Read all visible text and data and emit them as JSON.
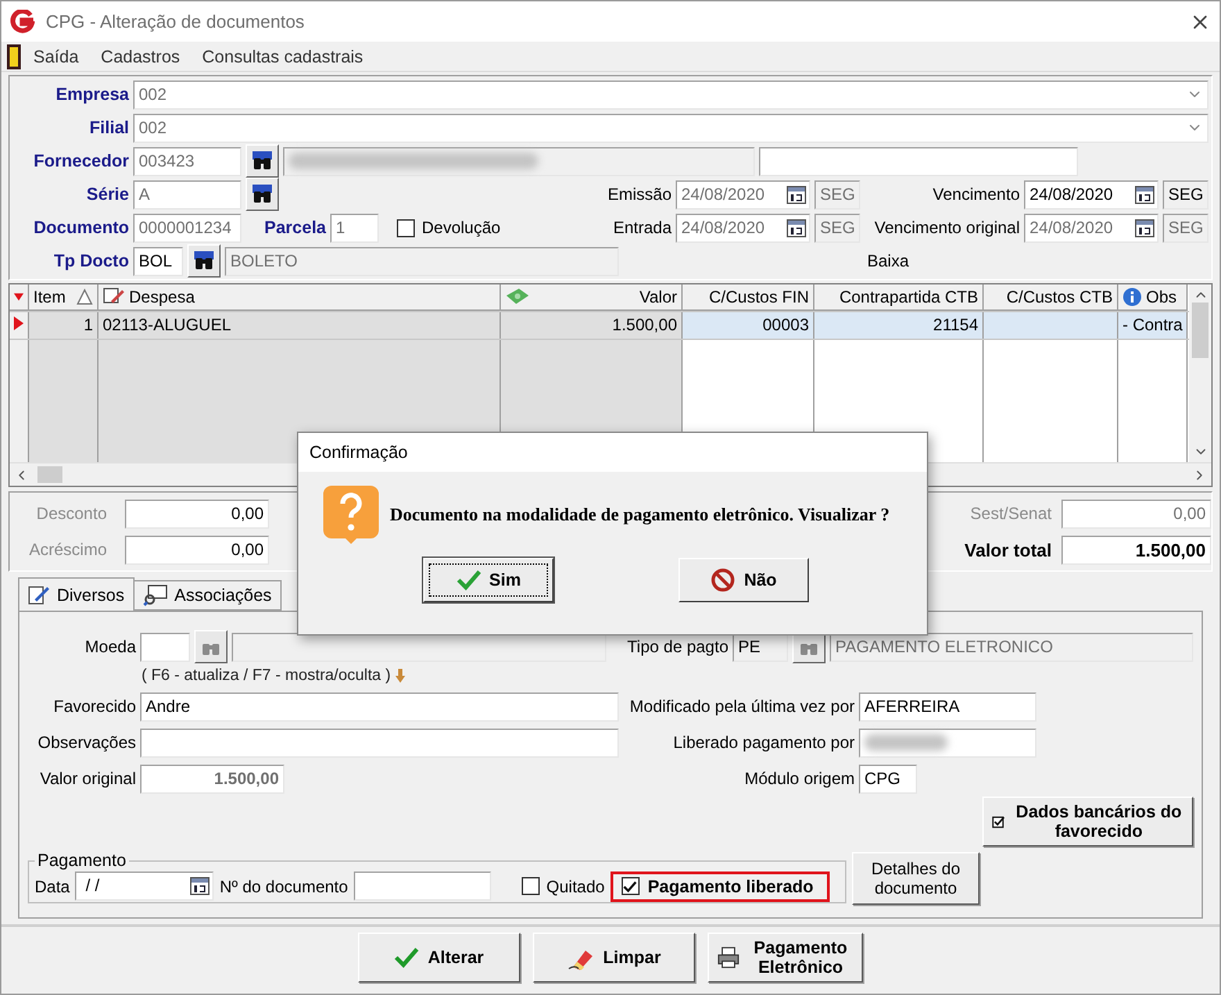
{
  "window": {
    "title": "CPG - Alteração de documentos"
  },
  "menu": [
    {
      "label": "Saída"
    },
    {
      "label": "Cadastros"
    },
    {
      "label": "Consultas cadastrais"
    }
  ],
  "header": {
    "empresa": {
      "label": "Empresa",
      "value": "002",
      "disabled": true
    },
    "filial": {
      "label": "Filial",
      "value": "002",
      "disabled": true
    },
    "fornecedor": {
      "label": "Fornecedor",
      "value": "003423",
      "disabled": true
    },
    "serie": {
      "label": "Série",
      "value": "A",
      "disabled": true
    },
    "documento": {
      "label": "Documento",
      "value": "0000001234",
      "disabled": true
    },
    "parcela": {
      "label": "Parcela",
      "value": "1",
      "disabled": true
    },
    "devolucao": {
      "label": "Devolução",
      "checked": false
    },
    "tp_docto": {
      "label": "Tp Docto",
      "value": "BOL",
      "description": "BOLETO",
      "disabled": false
    },
    "dates": [
      {
        "label": "Emissão",
        "value": "24/08/2020",
        "weekday": "SEG",
        "disabled": true
      },
      {
        "label": "Vencimento",
        "value": "24/08/2020",
        "weekday": "SEG",
        "disabled": false
      },
      {
        "label": "Entrada",
        "value": "24/08/2020",
        "weekday": "SEG",
        "disabled": true
      },
      {
        "label": "Vencimento original",
        "value": "24/08/2020",
        "weekday": "SEG",
        "disabled": true
      }
    ],
    "baixa": "Baixa"
  },
  "grid": {
    "columns": [
      {
        "label": "Item",
        "readonly": true
      },
      {
        "label": "Despesa",
        "readonly": true
      },
      {
        "label": "Valor",
        "readonly": true
      },
      {
        "label": "C/Custos FIN",
        "readonly": false
      },
      {
        "label": "Contrapartida CTB",
        "readonly": false
      },
      {
        "label": "C/Custos CTB",
        "readonly": false
      },
      {
        "label": "Obs",
        "readonly": false
      }
    ],
    "rows": [
      {
        "selected": true,
        "cells": [
          "1",
          "02113-ALUGUEL",
          "1.500,00",
          "00003",
          "21154",
          null,
          "- Contra"
        ]
      }
    ]
  },
  "totals": {
    "desconto": {
      "label": "Desconto",
      "value": "0,00"
    },
    "acrescimo": {
      "label": "Acréscimo",
      "value": "0,00"
    },
    "sest_senat": {
      "label": "Sest/Senat",
      "value": "0,00"
    },
    "valor_total": {
      "label": "Valor total",
      "value": "1.500,00"
    }
  },
  "tabs": [
    {
      "label": "Diversos",
      "selected": true
    },
    {
      "label": "Associações",
      "selected": false
    }
  ],
  "diversos": {
    "moeda": {
      "label": "Moeda"
    },
    "tipo_pagto": {
      "label": "Tipo de pagto",
      "value": "PE",
      "description": "PAGAMENTO ELETRONICO"
    },
    "hint": "( F6 - atualiza / F7 - mostra/oculta )",
    "favorecido": {
      "label": "Favorecido",
      "value": "Andre"
    },
    "observacoes": {
      "label": "Observações"
    },
    "valor_original": {
      "label": "Valor original",
      "value": "1.500,00"
    },
    "modificado": {
      "label": "Modificado pela última vez por",
      "value": "AFERREIRA"
    },
    "liberado_por": {
      "label": "Liberado pagamento por"
    },
    "modulo_origem": {
      "label": "Módulo origem",
      "value": "CPG"
    },
    "dados_bancarios": "Dados bancários do favorecido",
    "pagamento": {
      "legend": "Pagamento",
      "data": {
        "label": "Data",
        "value": " / /"
      },
      "numero_documento": {
        "label": "Nº do documento"
      },
      "quitado": {
        "label": "Quitado",
        "checked": false
      },
      "liberado": {
        "label": "Pagamento liberado",
        "checked": true,
        "highlighted": true
      }
    },
    "detalhes": "Detalhes do documento"
  },
  "actions": [
    {
      "label": "Alterar",
      "kind": "check"
    },
    {
      "label": "Limpar",
      "kind": "eraser"
    },
    {
      "label": "Pagamento Eletrônico",
      "kind": "printer"
    }
  ],
  "dialog": {
    "title": "Confirmação",
    "message": "Documento na modalidade de pagamento eletrônico. Visualizar ?",
    "buttons": [
      {
        "label": "Sim",
        "kind": "yes",
        "focused": true
      },
      {
        "label": "Não",
        "kind": "no",
        "focused": false
      }
    ]
  }
}
